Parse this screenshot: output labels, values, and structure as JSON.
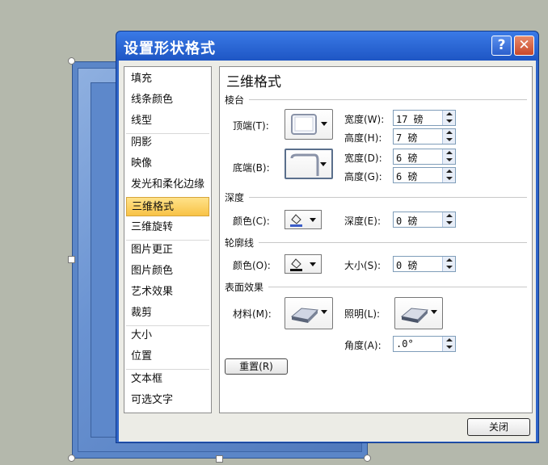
{
  "dialog": {
    "title": "设置形状格式",
    "help_label": "?",
    "close_x": "✕",
    "close_button": "关闭"
  },
  "nav": {
    "items": [
      {
        "label": "填充"
      },
      {
        "label": "线条颜色"
      },
      {
        "label": "线型"
      },
      {
        "label": "阴影"
      },
      {
        "label": "映像"
      },
      {
        "label": "发光和柔化边缘"
      },
      {
        "label": "三维格式",
        "active": true
      },
      {
        "label": "三维旋转"
      },
      {
        "label": "图片更正"
      },
      {
        "label": "图片颜色"
      },
      {
        "label": "艺术效果"
      },
      {
        "label": "裁剪"
      },
      {
        "label": "大小"
      },
      {
        "label": "位置"
      },
      {
        "label": "文本框"
      },
      {
        "label": "可选文字"
      }
    ]
  },
  "panel": {
    "heading": "三维格式",
    "bevel": {
      "section": "棱台",
      "top_label": "顶端(T):",
      "bottom_label": "底端(B):",
      "top_width_label": "宽度(W):",
      "top_width": "17 磅",
      "top_height_label": "高度(H):",
      "top_height": "7 磅",
      "bottom_width_label": "宽度(D):",
      "bottom_width": "6 磅",
      "bottom_height_label": "高度(G):",
      "bottom_height": "6 磅"
    },
    "depth": {
      "section": "深度",
      "color_label": "颜色(C):",
      "depth_label": "深度(E):",
      "depth_value": "0 磅"
    },
    "contour": {
      "section": "轮廓线",
      "color_label": "颜色(O):",
      "size_label": "大小(S):",
      "size_value": "0 磅"
    },
    "surface": {
      "section": "表面效果",
      "material_label": "材料(M):",
      "lighting_label": "照明(L):",
      "angle_label": "角度(A):",
      "angle_value": ".0°"
    },
    "reset_label": "重置(R)"
  }
}
